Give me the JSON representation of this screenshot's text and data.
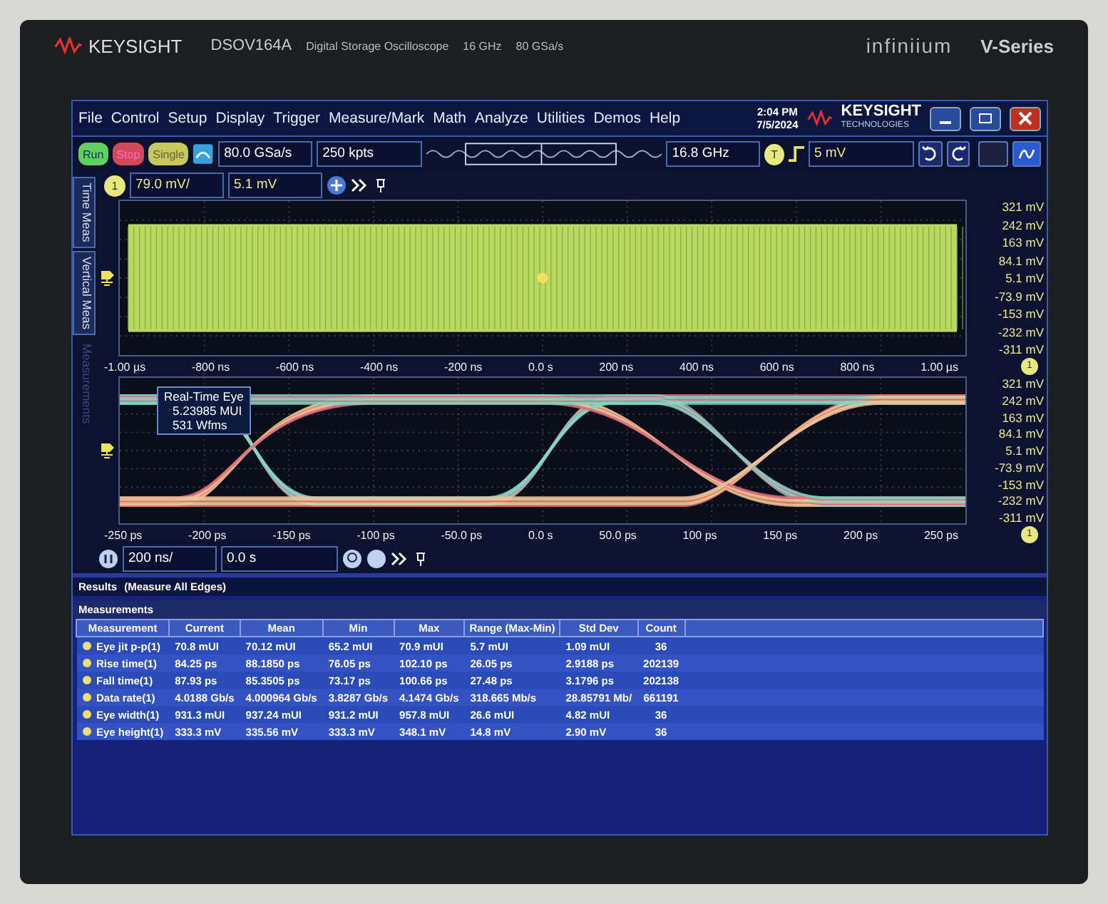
{
  "bezel": {
    "brand": "KEYSIGHT",
    "model": "DSOV164A",
    "description": "Digital Storage Oscilloscope",
    "bandwidth": "16 GHz",
    "sample_rate": "80 GSa/s",
    "product": "infiniium",
    "series": "V-Series"
  },
  "menu": {
    "items": [
      "File",
      "Control",
      "Setup",
      "Display",
      "Trigger",
      "Measure/Mark",
      "Math",
      "Analyze",
      "Utilities",
      "Demos",
      "Help"
    ],
    "time": "2:04 PM",
    "date": "7/5/2024",
    "logo": "KEYSIGHT",
    "logo_sub": "TECHNOLOGIES"
  },
  "toolbar": {
    "buttons": [
      {
        "label": "Run",
        "kind": "run"
      },
      {
        "label": "Stop",
        "kind": "stop"
      },
      {
        "label": "Single",
        "kind": "single"
      }
    ],
    "sample_rate": "80.0 GSa/s",
    "memory": "250 kpts",
    "bandwidth": "16.8 GHz",
    "trigger_badge": "T",
    "trigger_level": "5 mV"
  },
  "channel_bar": {
    "badge": "1",
    "scale": "79.0 mV/",
    "offset": "5.1 mV"
  },
  "side_tabs": [
    {
      "label": "Time Meas",
      "disabled": false
    },
    {
      "label": "Vertical Meas",
      "disabled": false
    },
    {
      "label": "Measurements",
      "disabled": true
    }
  ],
  "upper_plot": {
    "y_labels": [
      "321 mV",
      "242 mV",
      "163 mV",
      "84.1 mV",
      "5.1 mV",
      "-73.9 mV",
      "-153 mV",
      "-232 mV",
      "-311 mV"
    ],
    "x_labels": [
      "-1.00 µs",
      "-800 ns",
      "-600 ns",
      "-400 ns",
      "-200 ns",
      "0.0 s",
      "200 ns",
      "400 ns",
      "600 ns",
      "800 ns",
      "1.00 µs"
    ],
    "marker": "1"
  },
  "eye_plot": {
    "overlay": [
      "Real-Time Eye",
      "5.23985 MUI",
      "531 Wfms"
    ],
    "y_labels": [
      "321 mV",
      "242 mV",
      "163 mV",
      "84.1 mV",
      "5.1 mV",
      "-73.9 mV",
      "-153 mV",
      "-232 mV",
      "-311 mV"
    ],
    "x_labels": [
      "-250 ps",
      "-200 ps",
      "-150 ps",
      "-100 ps",
      "-50.0 ps",
      "0.0 s",
      "50.0 ps",
      "100 ps",
      "150 ps",
      "200 ps",
      "250 ps"
    ],
    "marker": "1"
  },
  "timebase_bar": {
    "scale": "200 ns/",
    "position": "0.0 s"
  },
  "results": {
    "title": "Results",
    "subtitle": "(Measure All Edges)",
    "panel_title": "Measurements",
    "columns": [
      "Measurement",
      "Current",
      "Mean",
      "Min",
      "Max",
      "Range (Max-Min)",
      "Std Dev",
      "Count"
    ],
    "rows": [
      [
        "Eye jit p-p(1)",
        "70.8 mUI",
        "70.12 mUI",
        "65.2 mUI",
        "70.9 mUI",
        "5.7 mUI",
        "1.09 mUI",
        "36"
      ],
      [
        "Rise time(1)",
        "84.25 ps",
        "88.1850 ps",
        "76.05 ps",
        "102.10 ps",
        "26.05 ps",
        "2.9188 ps",
        "202139"
      ],
      [
        "Fall time(1)",
        "87.93 ps",
        "85.3505 ps",
        "73.17 ps",
        "100.66 ps",
        "27.48 ps",
        "3.1796 ps",
        "202138"
      ],
      [
        "Data rate(1)",
        "4.0188 Gb/s",
        "4.000964 Gb/s",
        "3.8287 Gb/s",
        "4.1474 Gb/s",
        "318.665 Mb/s",
        "28.85791 Mb/",
        "661191"
      ],
      [
        "Eye width(1)",
        "931.3 mUI",
        "937.24 mUI",
        "931.2 mUI",
        "957.8 mUI",
        "26.6 mUI",
        "4.82 mUI",
        "36"
      ],
      [
        "Eye height(1)",
        "333.3 mV",
        "335.56 mV",
        "333.3 mV",
        "348.1 mV",
        "14.8 mV",
        "2.90 mV",
        "36"
      ]
    ]
  }
}
